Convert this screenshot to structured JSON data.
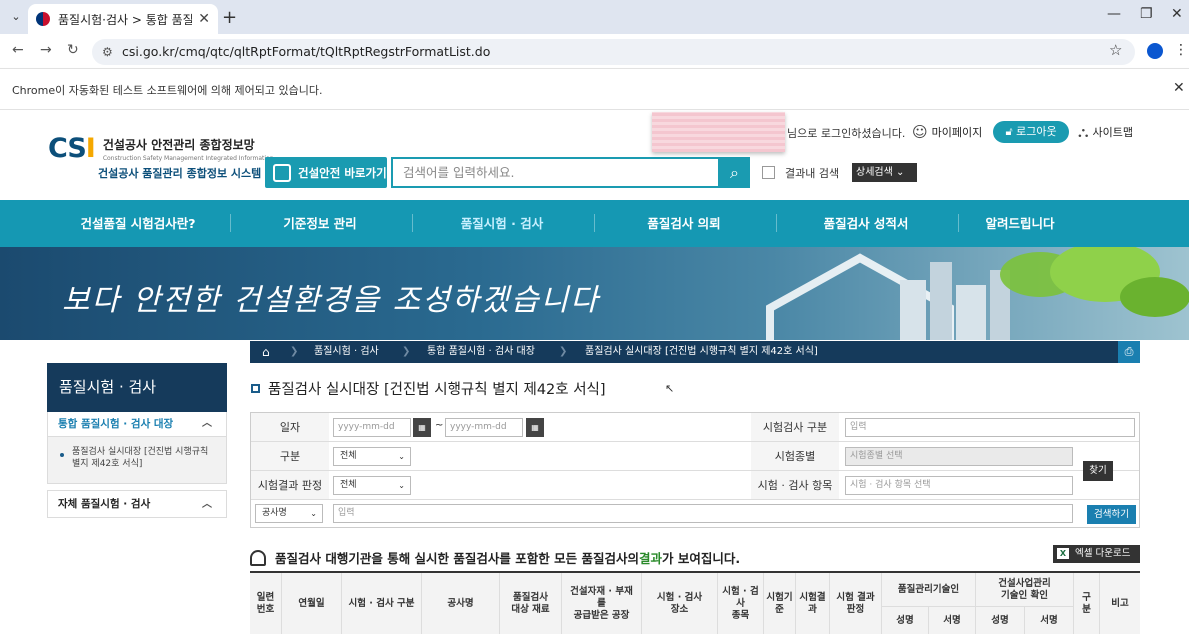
{
  "browser": {
    "tab_title": "품질시험·검사 > 통합 품질시험",
    "url": "csi.go.kr/cmq/qtc/qltRptFormat/tQltRptRegstrFormatList.do",
    "automation_notice": "Chrome이 자동화된 테스트 소프트웨어에 의해 제어되고 있습니다."
  },
  "header": {
    "logo_mark": "CSI",
    "logo_title": "건설공사 안전관리 종합정보망",
    "logo_subtitle": "Construction Safety Management Integrated Information",
    "system_name": "건설공사 품질관리 종합정보 시스템",
    "safety_link": "건설안전 바로가기",
    "search_placeholder": "검색어를 입력하세요.",
    "search_within": "결과내 검색",
    "detail_search": "상세검색",
    "login_msg": "님으로 로그인하셨습니다.",
    "mypage": "마이페이지",
    "logout": "로그아웃",
    "sitemap": "사이트맵"
  },
  "menu": [
    "건설품질 시험검사란?",
    "기준정보 관리",
    "품질시험 · 검사",
    "품질검사 의뢰",
    "품질검사 성적서",
    "알려드립니다"
  ],
  "banner": {
    "slogan": "보다 안전한 건설환경을 조성하겠습니다"
  },
  "sidebar": {
    "title": "품질시험 · 검사",
    "section1": "통합 품질시험 · 검사 대장",
    "item1": "품질검사 실시대장 [건진법 시행규칙 별지 제42호 서식]",
    "section2": "자체 품질시험 · 검사"
  },
  "breadcrumb": [
    "품질시험 · 검사",
    "통합 품질시험 · 검사 대장",
    "품질검사 실시대장 [건진법 시행규칙 별지 제42호 서식]"
  ],
  "page_title": "품질검사 실시대장 [건진법 시행규칙 별지 제42호 서식]",
  "form": {
    "date_label": "일자",
    "date_placeholder": "yyyy-mm-dd",
    "tilde": "~",
    "type_label": "구분",
    "type_value": "전체",
    "result_label": "시험결과 판정",
    "result_value": "전체",
    "insp_type_label": "시험검사 구분",
    "insp_type_placeholder": "입력",
    "test_kind_label": "시험종별",
    "test_kind_placeholder": "시험종별 선택",
    "item_label": "시험 · 검사 항목",
    "item_placeholder": "시험 · 검사 항목 선택",
    "find_btn": "찾기",
    "search_field": "공사명",
    "search_placeholder": "입력",
    "search_btn": "검색하기"
  },
  "notice": {
    "pre": "품질검사 대행기관을 통해 실시한 품질검사를 포함한 모든 품질검사의 ",
    "hl": "결과",
    "post": "가 보여집니다."
  },
  "excel_btn": "엑셀 다운로드",
  "table_headers": {
    "c1": "일련\n번호",
    "c2": "연월일",
    "c3": "시험 · 검사 구분",
    "c4": "공사명",
    "c5": "품질검사\n대상 재료",
    "c6": "건설자재 · 부재\n를\n공급받은 공장",
    "c7": "시험 · 검사\n장소",
    "c8": "시험 · 검\n사\n종목",
    "c9": "시험기\n준",
    "c10": "시험결\n과",
    "c11": "시험 결과\n판정",
    "g1": "품질관리기술인",
    "g2": "건설사업관리\n기술인 확인",
    "s1": "성명",
    "s2": "서명",
    "s3": "성명",
    "s4": "서명",
    "c12": "구\n분",
    "c13": "비고"
  }
}
